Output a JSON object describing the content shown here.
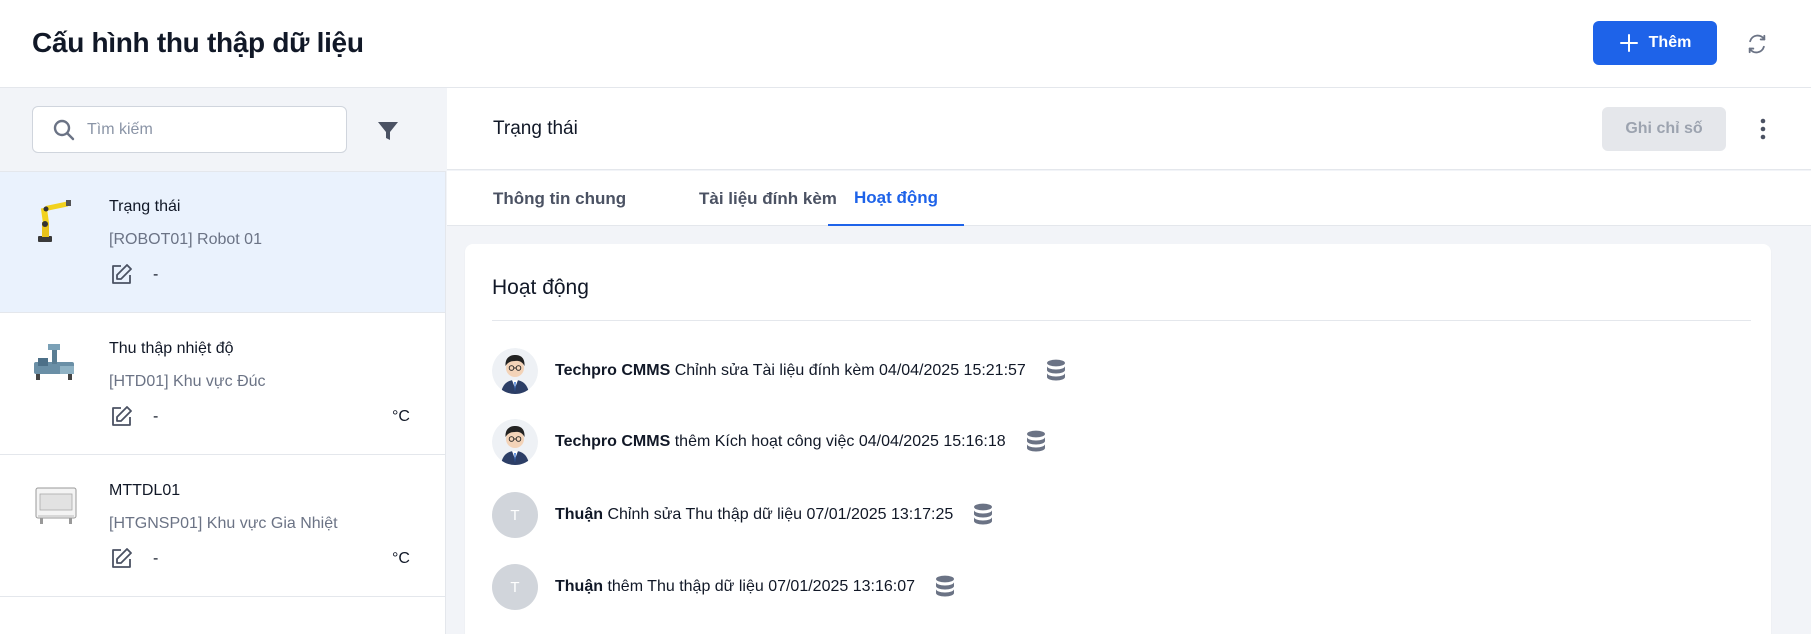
{
  "header": {
    "title": "Cấu hình thu thập dữ liệu",
    "add_label": "Thêm"
  },
  "search": {
    "placeholder": "Tìm kiếm"
  },
  "items": [
    {
      "name": "Trạng thái",
      "code": "[ROBOT01] Robot 01",
      "value": "-",
      "unit": "",
      "thumb": "robot-arm-image"
    },
    {
      "name": "Thu thập nhiệt độ",
      "code": "[HTD01] Khu vực Đúc",
      "value": "-",
      "unit": "°C",
      "thumb": "machine-image"
    },
    {
      "name": "MTTDL01",
      "code": "[HTGNSP01] Khu vực Gia Nhiệt",
      "value": "-",
      "unit": "°C",
      "thumb": "device-image"
    }
  ],
  "detail": {
    "title": "Trạng thái",
    "record_label": "Ghi chỉ số",
    "tabs": [
      "Thông tin chung",
      "Tài liệu đính kèm",
      "Hoạt động"
    ],
    "active_tab": "Hoạt động",
    "card_title": "Hoạt động",
    "activities": [
      {
        "who": "Techpro CMMS",
        "action": "Chỉnh sửa Tài liệu đính kèm 04/04/2025 15:21:57",
        "avatar": "person-avatar"
      },
      {
        "who": "Techpro CMMS",
        "action": "thêm Kích hoạt công việc 04/04/2025 15:16:18",
        "avatar": "person-avatar"
      },
      {
        "who": "Thuận",
        "action": "Chỉnh sửa Thu thập dữ liệu 07/01/2025 13:17:25",
        "avatar_letter": "T"
      },
      {
        "who": "Thuận",
        "action": "thêm Thu thập dữ liệu 07/01/2025 13:16:07",
        "avatar_letter": "T"
      }
    ]
  },
  "colors": {
    "primary": "#1e63e9",
    "selected_bg": "#eaf2fd",
    "page_bg": "#f2f4f8",
    "muted_text": "#6b7385",
    "db_icon": "#6b7385"
  }
}
